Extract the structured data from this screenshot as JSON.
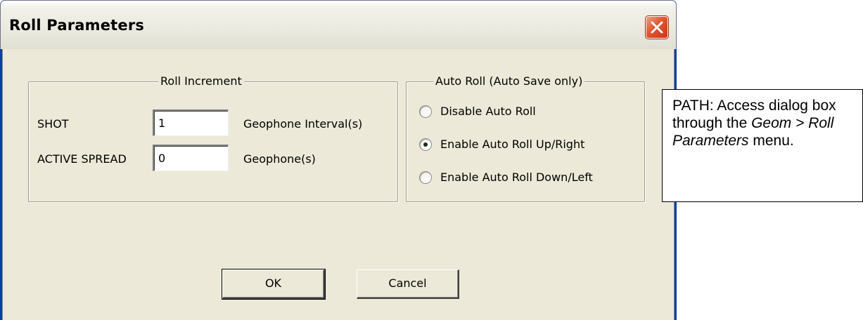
{
  "dialog": {
    "title": "Roll Parameters",
    "close_icon": "close-x-icon",
    "roll_increment": {
      "title": "Roll Increment",
      "shot_label": "SHOT",
      "shot_value": "1",
      "shot_unit": "Geophone Interval(s)",
      "spread_label": "ACTIVE SPREAD",
      "spread_value": "0",
      "spread_unit": "Geophone(s)"
    },
    "auto_roll": {
      "title": "Auto Roll (Auto Save only)",
      "options": [
        {
          "label": "Disable Auto Roll",
          "selected": false
        },
        {
          "label": "Enable Auto Roll Up/Right",
          "selected": true
        },
        {
          "label": "Enable Auto Roll Down/Left",
          "selected": false
        }
      ]
    },
    "ok_label": "OK",
    "cancel_label": "Cancel"
  },
  "note": {
    "prefix": "PATH: Access dialog box through the ",
    "menu_path": "Geom > Roll Parameters",
    "suffix": " menu."
  },
  "colors": {
    "titlebar_close": "#e2552d",
    "dialog_face": "#ece9d8",
    "window_frame": "#0b3fa8"
  }
}
